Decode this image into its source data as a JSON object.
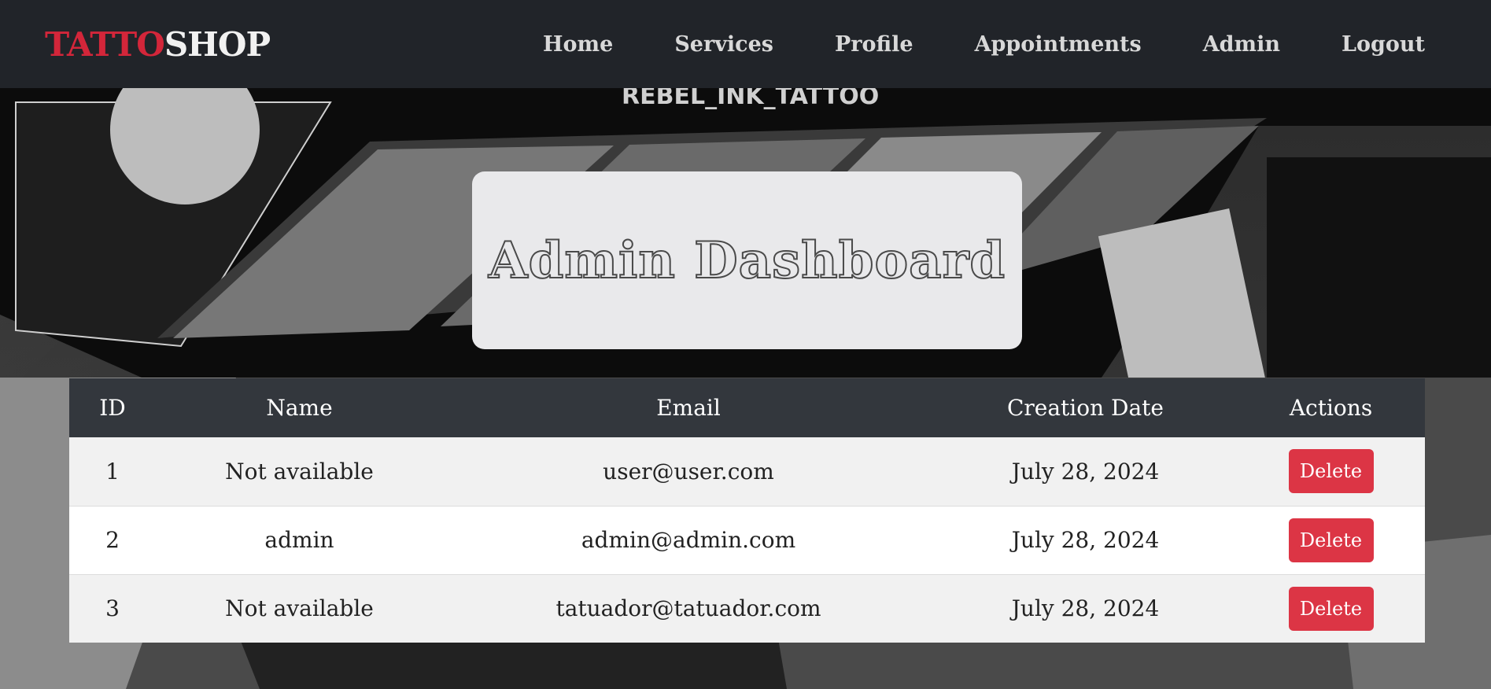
{
  "brand": {
    "part1": "TATTO",
    "part2": "SHOP"
  },
  "nav": {
    "items": [
      {
        "label": "Home"
      },
      {
        "label": "Services"
      },
      {
        "label": "Profile"
      },
      {
        "label": "Appointments"
      },
      {
        "label": "Admin"
      },
      {
        "label": "Logout"
      }
    ]
  },
  "page": {
    "title": "Admin Dashboard"
  },
  "table": {
    "headers": {
      "id": "ID",
      "name": "Name",
      "email": "Email",
      "creation_date": "Creation Date",
      "actions": "Actions"
    },
    "rows": [
      {
        "id": "1",
        "name": "Not available",
        "email": "user@user.com",
        "creation_date": "July 28, 2024",
        "action_label": "Delete"
      },
      {
        "id": "2",
        "name": "admin",
        "email": "admin@admin.com",
        "creation_date": "July 28, 2024",
        "action_label": "Delete"
      },
      {
        "id": "3",
        "name": "Not available",
        "email": "tatuador@tatuador.com",
        "creation_date": "July 28, 2024",
        "action_label": "Delete"
      }
    ]
  },
  "colors": {
    "navbar_bg": "#212429",
    "brand_accent": "#d3263a",
    "table_header_bg": "#33373d",
    "delete_button": "#dc3545",
    "title_card_bg": "#e9e9eb"
  }
}
